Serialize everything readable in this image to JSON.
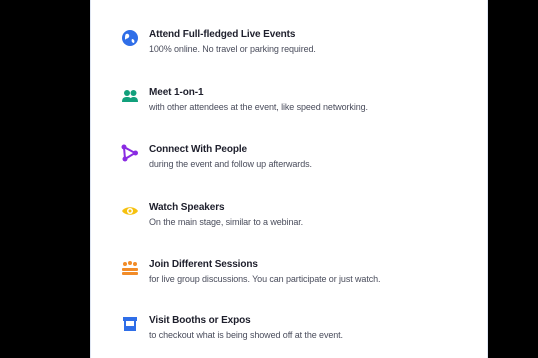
{
  "features": [
    {
      "icon": "globe-icon",
      "color": "#2f6ee8",
      "title": "Attend Full-fledged Live Events",
      "desc": "100% online. No travel or parking required."
    },
    {
      "icon": "people-icon",
      "color": "#12a07c",
      "title": "Meet 1-on-1",
      "desc": "with other attendees at the event, like speed networking."
    },
    {
      "icon": "network-icon",
      "color": "#8a2be2",
      "title": "Connect With People",
      "desc": "during the event and follow up afterwards."
    },
    {
      "icon": "eye-icon",
      "color": "#f6c10e",
      "title": "Watch Speakers",
      "desc": "On the main stage, similar to a webinar."
    },
    {
      "icon": "group-icon",
      "color": "#f28c28",
      "title": "Join Different Sessions",
      "desc": "for live group discussions. You can participate or just watch."
    },
    {
      "icon": "booth-icon",
      "color": "#2f6ee8",
      "title": "Visit Booths or Expos",
      "desc": "to checkout what is being showed off at the event."
    }
  ]
}
